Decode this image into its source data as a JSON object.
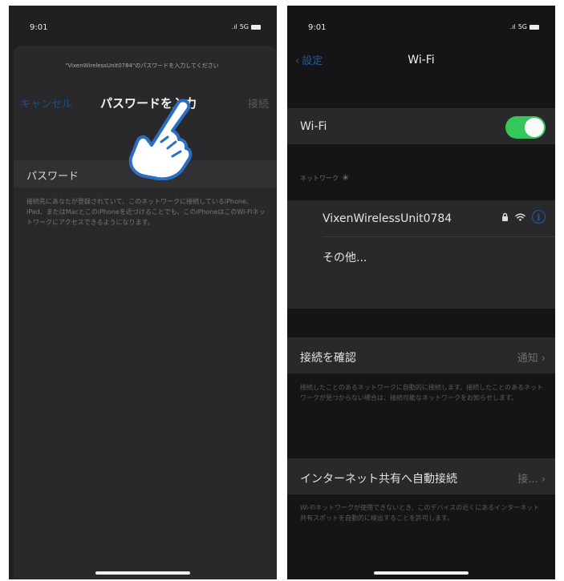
{
  "status_bar": {
    "time": "9:01",
    "network": "5G"
  },
  "password_sheet": {
    "prompt": "\"VixenWirelessUnit0784\"のパスワードを入力してください",
    "cancel_label": "キャンセル",
    "title": "パスワードを入力",
    "join_label": "接続",
    "password_field_label": "パスワード",
    "note": "接続先にあなたが登録されていて、このネットワークに接続しているiPhone、iPad、またはMacとこのiPhoneを近づけることでも、このiPhoneはこのWi-Fiネットワークにアクセスできるようになります。"
  },
  "wifi_screen": {
    "back_label": "設定",
    "title": "Wi-Fi",
    "wifi_label": "Wi-Fi",
    "wifi_on": true,
    "networks_header": "ネットワーク",
    "networks": [
      {
        "name": "VixenWirelessUnit0784",
        "secured": true
      }
    ],
    "other_label": "その他...",
    "ask_to_join": {
      "label": "接続を確認",
      "value": "通知"
    },
    "ask_to_join_note": "接続したことのあるネットワークに自動的に接続します。接続したことのあるネットワークが見つからない場合は、接続可能なネットワークをお知らせします。",
    "hotspot": {
      "label": "インターネット共有へ自動接続",
      "value": "接..."
    },
    "hotspot_note": "Wi-Fiネットワークが使用できないとき、このデバイスの近くにあるインターネット共有スポットを自動的に検出することを許可します。"
  },
  "colors": {
    "accent": "#1e5aa3",
    "toggle_on": "#34c759",
    "background": "#151517"
  },
  "icons": [
    "hand-pointer-icon",
    "chevron-left-icon",
    "spinner-icon",
    "lock-icon",
    "wifi-icon",
    "info-icon",
    "chevron-right-icon",
    "battery-icon",
    "signal-icon"
  ]
}
